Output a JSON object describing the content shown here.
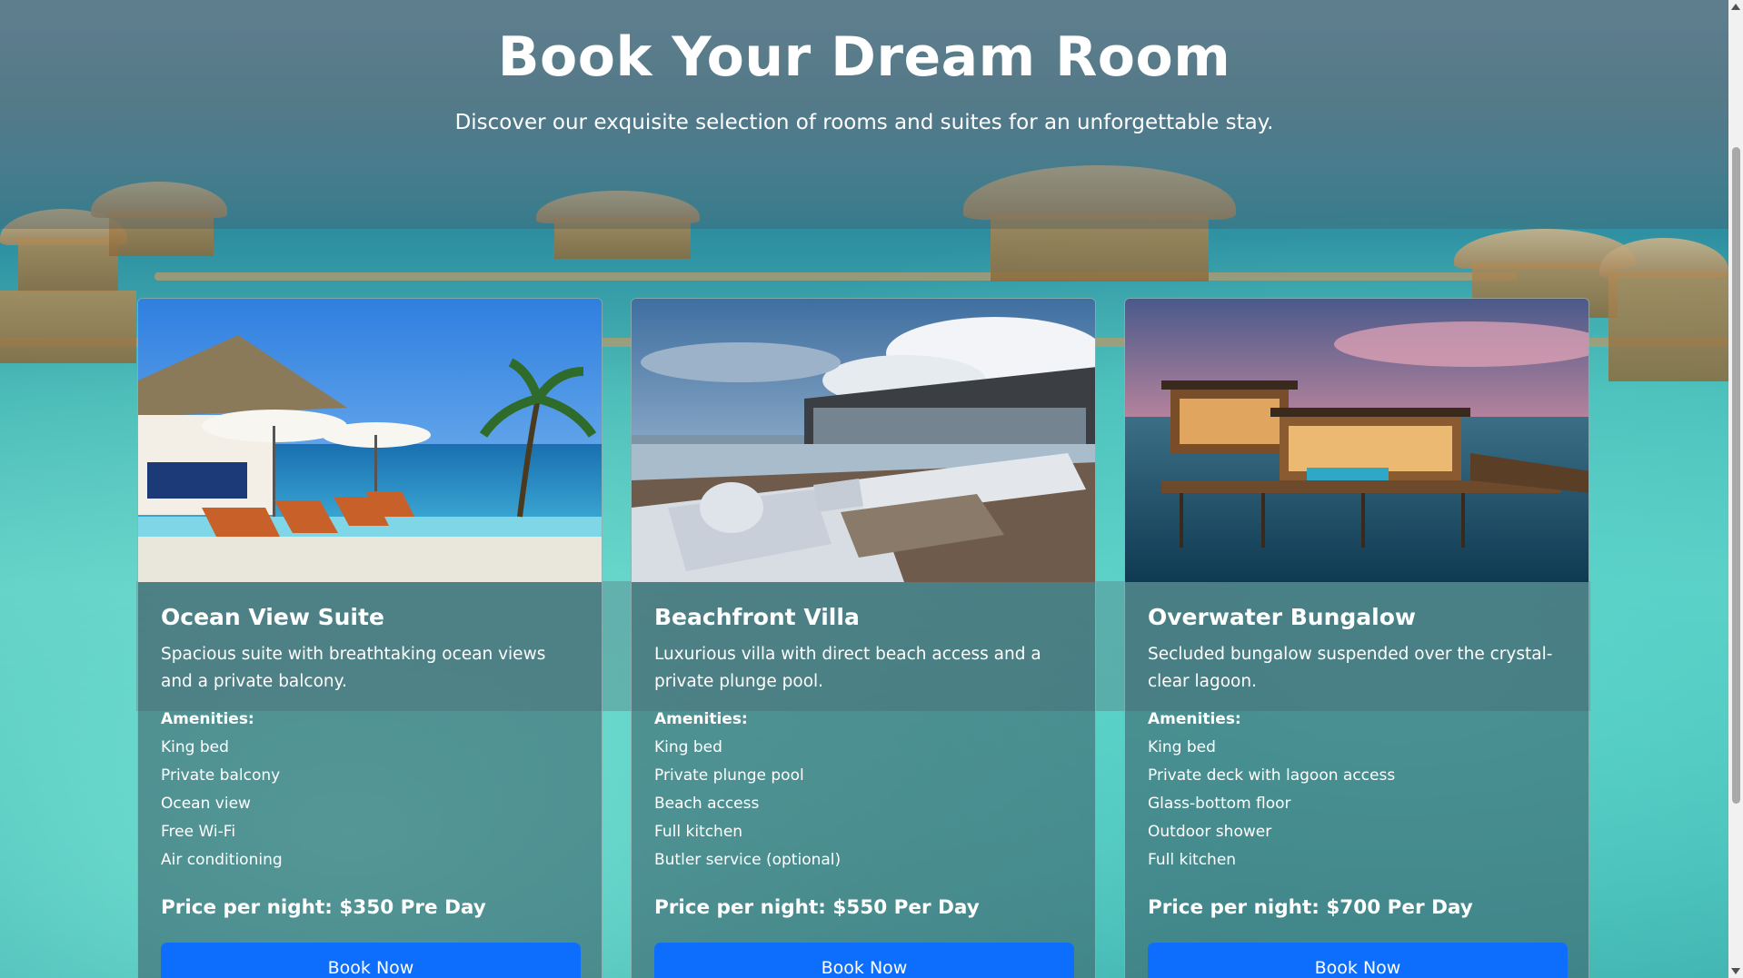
{
  "header": {
    "title": "Book Your Dream Room",
    "subtitle": "Discover our exquisite selection of rooms and suites for an unforgettable stay."
  },
  "rooms": [
    {
      "name": "Ocean View Suite",
      "description": "Spacious suite with breathtaking ocean views and a private balcony.",
      "amenities_label": "Amenities:",
      "amenities": [
        "King bed",
        "Private balcony",
        "Ocean view",
        "Free Wi-Fi",
        "Air conditioning"
      ],
      "price": "Price per night: $350 Pre Day",
      "button_label": "Book Now"
    },
    {
      "name": "Beachfront Villa",
      "description": "Luxurious villa with direct beach access and a private plunge pool.",
      "amenities_label": "Amenities:",
      "amenities": [
        "King bed",
        "Private plunge pool",
        "Beach access",
        "Full kitchen",
        "Butler service (optional)"
      ],
      "price": "Price per night: $550 Per Day",
      "button_label": "Book Now"
    },
    {
      "name": "Overwater Bungalow",
      "description": "Secluded bungalow suspended over the crystal-clear lagoon.",
      "amenities_label": "Amenities:",
      "amenities": [
        "King bed",
        "Private deck with lagoon access",
        "Glass-bottom floor",
        "Outdoor shower",
        "Full kitchen"
      ],
      "price": "Price per night: $700 Per Day",
      "button_label": "Book Now"
    }
  ],
  "colors": {
    "button": "#0d6efd",
    "text": "#ffffff",
    "lagoon": "#5cc9c0"
  }
}
